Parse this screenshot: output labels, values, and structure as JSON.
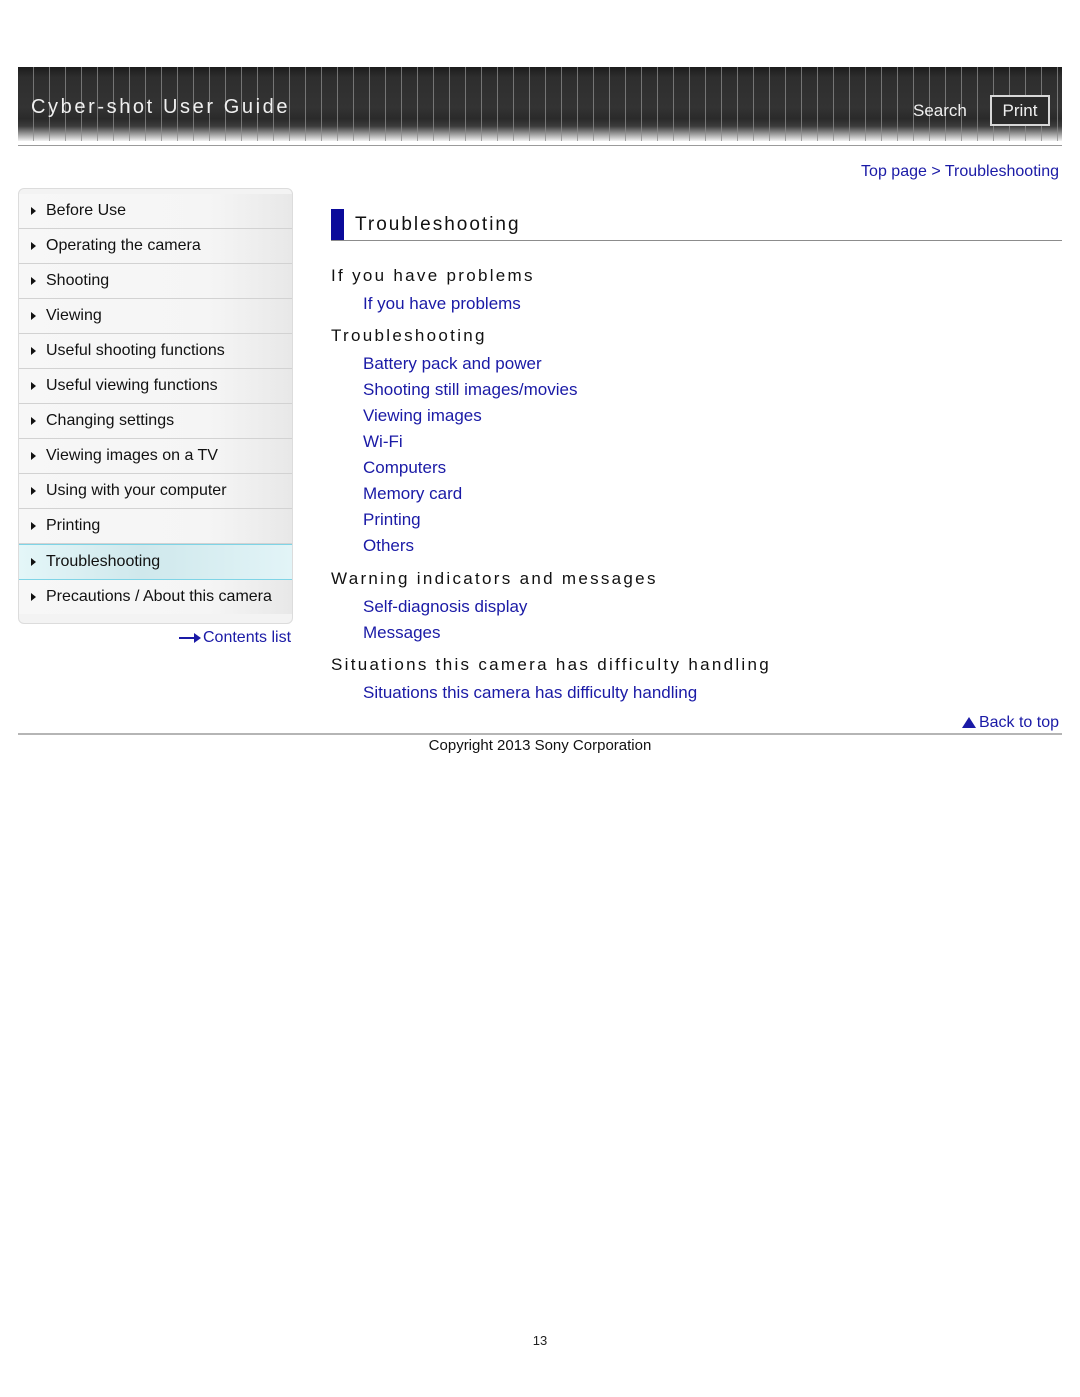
{
  "header": {
    "title": "Cyber-shot User Guide",
    "search_label": "Search",
    "print_label": "Print"
  },
  "breadcrumb": {
    "items": [
      "Top page",
      "Troubleshooting"
    ],
    "separator": ">"
  },
  "sidebar": {
    "items": [
      {
        "label": "Before Use",
        "active": false
      },
      {
        "label": "Operating the camera",
        "active": false
      },
      {
        "label": "Shooting",
        "active": false
      },
      {
        "label": "Viewing",
        "active": false
      },
      {
        "label": "Useful shooting functions",
        "active": false
      },
      {
        "label": "Useful viewing functions",
        "active": false
      },
      {
        "label": "Changing settings",
        "active": false
      },
      {
        "label": "Viewing images on a TV",
        "active": false
      },
      {
        "label": "Using with your computer",
        "active": false
      },
      {
        "label": "Printing",
        "active": false
      },
      {
        "label": "Troubleshooting",
        "active": true
      },
      {
        "label": "Precautions / About this camera",
        "active": false
      }
    ],
    "contents_list_label": "Contents list"
  },
  "main": {
    "title": "Troubleshooting",
    "sections": [
      {
        "heading": "If you have problems",
        "links": [
          "If you have problems"
        ]
      },
      {
        "heading": "Troubleshooting",
        "links": [
          "Battery pack and power",
          "Shooting still images/movies",
          "Viewing images",
          "Wi-Fi",
          "Computers",
          "Memory card",
          "Printing",
          "Others"
        ]
      },
      {
        "heading": "Warning indicators and messages",
        "links": [
          "Self-diagnosis display",
          "Messages"
        ]
      },
      {
        "heading": "Situations this camera has difficulty handling",
        "links": [
          "Situations this camera has difficulty handling"
        ]
      }
    ]
  },
  "footer": {
    "back_to_top": "Back to top",
    "copyright": "Copyright 2013 Sony Corporation",
    "page_number": "13"
  },
  "colors": {
    "link": "#1a1aa6",
    "title_accent": "#0a0a9a",
    "active_nav_border": "#7fd4e6"
  }
}
